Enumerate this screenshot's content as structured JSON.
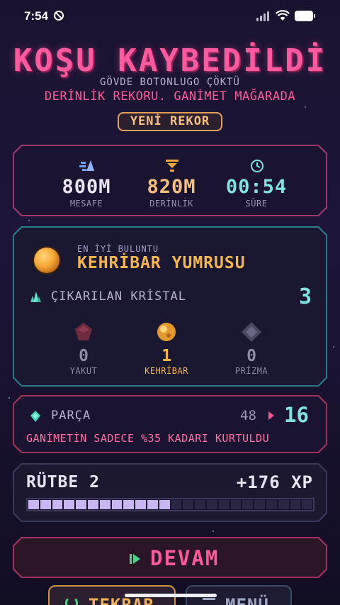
{
  "status_bar": {
    "time": "7:54"
  },
  "header": {
    "title": "KOŞU KAYBEDİLDİ",
    "subtitle": "GÖVDE BOTONLUGO ÇÖKTÜ",
    "record_line": "DERİNLİK REKORU. GANİMET MAĞARADA",
    "badge": "YENİ REKOR"
  },
  "stats": [
    {
      "value": "800M",
      "label": "MESAFE",
      "icon": "distance-icon",
      "color": "#e9e6f6"
    },
    {
      "value": "820M",
      "label": "DERİNLİK",
      "icon": "depth-arrow-icon",
      "color": "#f6c07f"
    },
    {
      "value": "00:54",
      "label": "SÜRE",
      "icon": "clock-icon",
      "color": "#7fe3e0"
    }
  ],
  "loot": {
    "best_label": "EN İYİ BULUNTU",
    "best_name": "KEHRİBAR YUMRUSU",
    "crystal_label": "ÇIKARILAN KRİSTAL",
    "crystal_count": "3",
    "gems": [
      {
        "count": "0",
        "label": "YAKUT",
        "icon": "ruby-icon",
        "color": "#8d8aa4"
      },
      {
        "count": "1",
        "label": "KEHRİBAR",
        "icon": "amber-icon",
        "color": "#f6b54a"
      },
      {
        "count": "0",
        "label": "PRİZMA",
        "icon": "prism-icon",
        "color": "#8d8aa4"
      }
    ]
  },
  "fragments": {
    "label": "PARÇA",
    "old_value": "48",
    "new_value": "16",
    "note": "GANİMETİN SADECE %35 KADARI KURTULDU"
  },
  "rank": {
    "label": "RÜTBE 2",
    "xp": "+176 XP",
    "progress": 0.5
  },
  "buttons": {
    "continue": "DEVAM",
    "retry": "TEKRAR",
    "menu": "MENÜ"
  },
  "colors": {
    "accent_pink": "#ff5aa0",
    "accent_cyan": "#7fe3e0",
    "accent_amber": "#f6b54a"
  }
}
